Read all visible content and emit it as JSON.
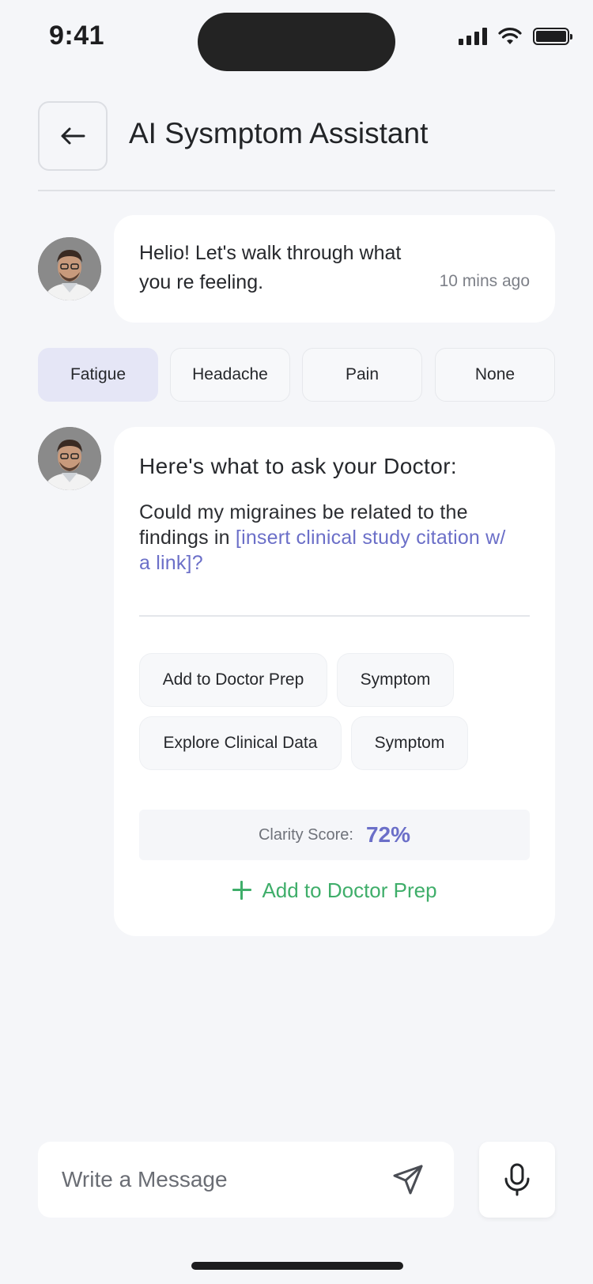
{
  "status_bar": {
    "time": "9:41"
  },
  "header": {
    "title": "AI Sysmptom Assistant"
  },
  "messages": [
    {
      "text": "Helio! Let's walk through what you re feeling.",
      "time": "10 mins ago"
    }
  ],
  "chips": [
    "Fatigue",
    "Headache",
    "Pain",
    "None"
  ],
  "card": {
    "heading": "Here's what to ask your Doctor:",
    "question_prefix": "Could my migraines be related to the findings in ",
    "question_link": "[insert clinical study citation w/ a link]?",
    "tags": [
      "Add to Doctor Prep",
      "Symptom",
      "Explore Clinical Data",
      "Symptom"
    ],
    "clarity_label": "Clarity Score:",
    "clarity_value": "72%",
    "add_label": "Add to Doctor Prep"
  },
  "composer": {
    "placeholder": "Write a Message"
  },
  "colors": {
    "accent": "#6b6fc8",
    "success": "#3fae6a",
    "chip_selected": "#e5e6f6"
  },
  "icons": {
    "back": "arrow-left-icon",
    "send": "send-icon",
    "mic": "microphone-icon",
    "add": "plus-icon"
  }
}
